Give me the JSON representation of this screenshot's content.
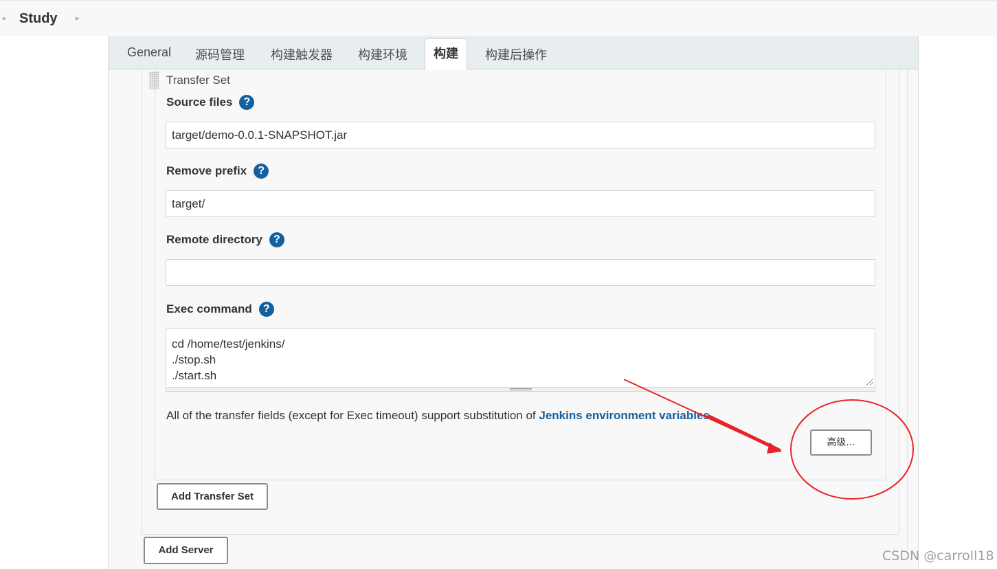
{
  "breadcrumb": {
    "project": "Study"
  },
  "tabs": [
    {
      "label": "General",
      "active": false
    },
    {
      "label": "源码管理",
      "active": false
    },
    {
      "label": "构建触发器",
      "active": false
    },
    {
      "label": "构建环境",
      "active": false
    },
    {
      "label": "构建",
      "active": true
    },
    {
      "label": "构建后操作",
      "active": false
    }
  ],
  "transfer_set": {
    "title": "Transfer Set",
    "source_files": {
      "label": "Source files",
      "value": "target/demo-0.0.1-SNAPSHOT.jar"
    },
    "remove_prefix": {
      "label": "Remove prefix",
      "value": "target/"
    },
    "remote_directory": {
      "label": "Remote directory",
      "value": ""
    },
    "exec_command": {
      "label": "Exec command",
      "value": "cd /home/test/jenkins/\n./stop.sh\n./start.sh"
    },
    "substitution_text": "All of the transfer fields (except for Exec timeout) support substitution of ",
    "substitution_link": "Jenkins environment variables",
    "advanced_button": "高级..."
  },
  "buttons": {
    "add_transfer_set": "Add Transfer Set",
    "add_server": "Add Server"
  },
  "help_glyph": "?",
  "watermark": "CSDN @carroll18",
  "colors": {
    "link": "#14609e",
    "help_icon": "#14609e",
    "annotation": "#e8232a",
    "tab_bar": "#e8eef0"
  }
}
